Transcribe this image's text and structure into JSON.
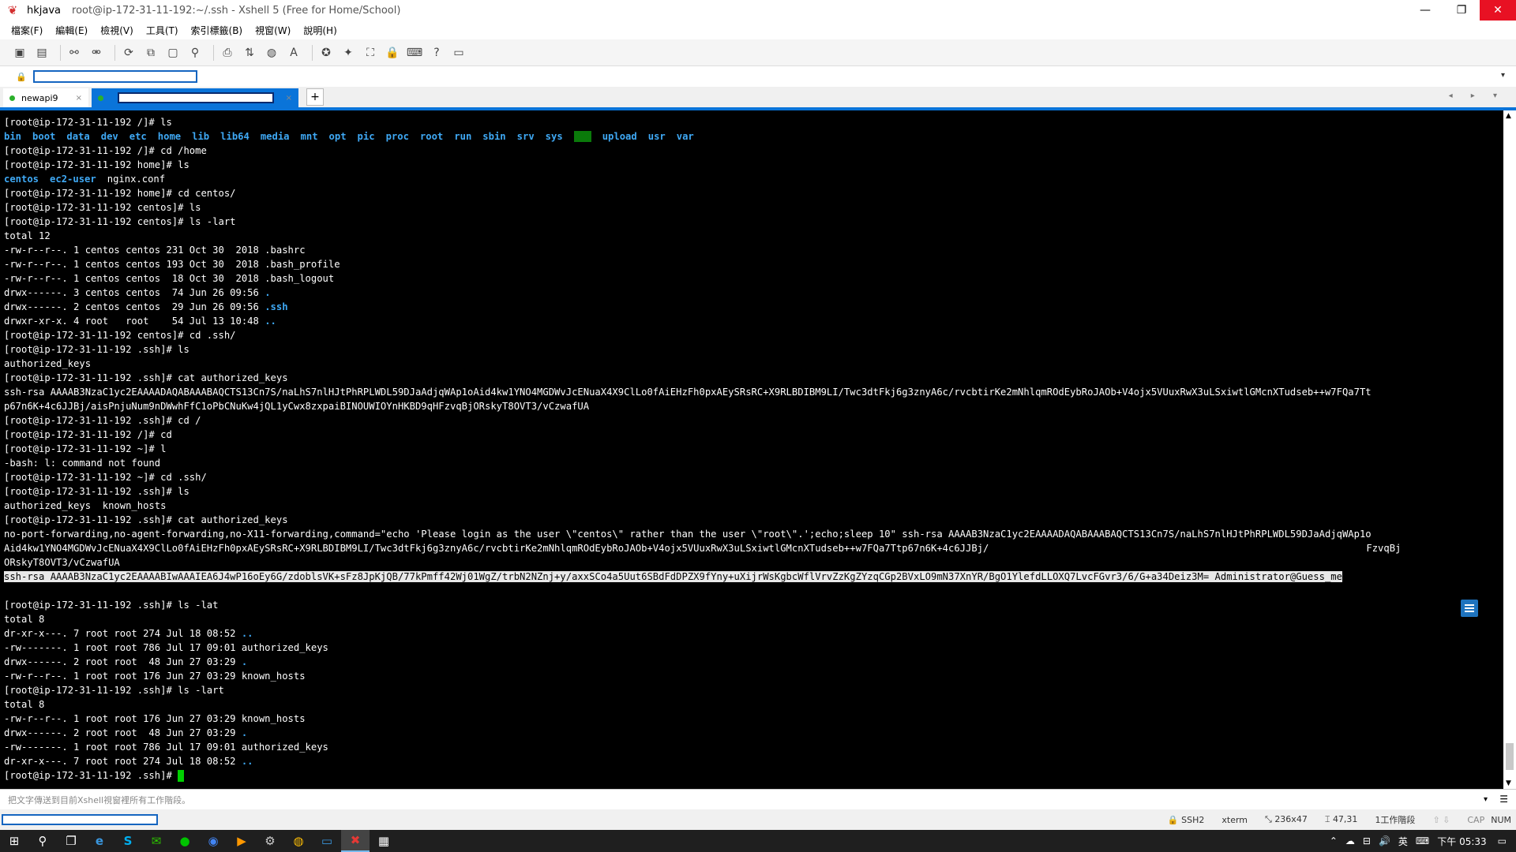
{
  "window": {
    "app_name": "hkjava",
    "path_title": "root@ip-172-31-11-192:~/.ssh - Xshell 5 (Free for Home/School)",
    "controls": {
      "minimize": "—",
      "restore": "❐",
      "close": "✕"
    }
  },
  "menu": [
    "檔案(F)",
    "編輯(E)",
    "檢視(V)",
    "工具(T)",
    "索引標籤(B)",
    "視窗(W)",
    "說明(H)"
  ],
  "tabs": {
    "tab1_label": "newapi9",
    "close_glyph": "×",
    "add_glyph": "+",
    "nav_glyphs": "◂ ▸ ▾"
  },
  "terminal": {
    "root_dirs": [
      "bin",
      "boot",
      "data",
      "dev",
      "etc",
      "home",
      "lib",
      "lib64",
      "media",
      "mnt",
      "opt",
      "pic",
      "proc",
      "root",
      "run",
      "sbin",
      "srv",
      "sys",
      "tmp",
      "upload",
      "usr",
      "var"
    ],
    "home_entries": [
      "centos",
      "ec2-user"
    ],
    "lines": {
      "l1": "[root@ip-172-31-11-192 /]# ls",
      "l3": "[root@ip-172-31-11-192 /]# cd /home",
      "l4": "[root@ip-172-31-11-192 home]# ls",
      "l5_file": "nginx.conf",
      "l6": "[root@ip-172-31-11-192 home]# cd centos/",
      "l7": "[root@ip-172-31-11-192 centos]# ls",
      "l8": "[root@ip-172-31-11-192 centos]# ls -lart",
      "l9": "total 12",
      "l10": "-rw-r--r--. 1 centos centos 231 Oct 30  2018 .bashrc",
      "l11": "-rw-r--r--. 1 centos centos 193 Oct 30  2018 .bash_profile",
      "l12": "-rw-r--r--. 1 centos centos  18 Oct 30  2018 .bash_logout",
      "l13_pre": "drwx------. 3 centos centos  74 Jun 26 09:56 ",
      "l13_dir": ".",
      "l14_pre": "drwx------. 2 centos centos  29 Jun 26 09:56 ",
      "l14_dir": ".ssh",
      "l15_pre": "drwxr-xr-x. 4 root   root    54 Jul 13 10:48 ",
      "l15_dir": "..",
      "l16": "[root@ip-172-31-11-192 centos]# cd .ssh/",
      "l17": "[root@ip-172-31-11-192 .ssh]# ls",
      "l18": "authorized_keys",
      "l19": "[root@ip-172-31-11-192 .ssh]# cat authorized_keys",
      "l20": "ssh-rsa AAAAB3NzaC1yc2EAAAADAQABAAABAQCTS13Cn7S/naLhS7nlHJtPhRPLWDL59DJaAdjqWAp1oAid4kw1YNO4MGDWvJcENuaX4X9ClLo0fAiEHzFh0pxAEySRsRC+X9RLBDIBM9LI/Twc3dtFkj6g3znyA6c/rvcbtirKe2mNhlqmROdEybRoJAOb+V4ojx5VUuxRwX3uLSxiwtlGMcnXTudseb++w7FQa7Tt",
      "l21": "p67n6K+4c6JJBj/aisPnjuNum9nDWwhFfC1oPbCNuKw4jQL1yCwx8zxpaiBINOUWIOYnHKBD9qHFzvqBjORskyT8OVT3/vCzwafUA",
      "l22": "[root@ip-172-31-11-192 .ssh]# cd /",
      "l23": "[root@ip-172-31-11-192 /]# cd",
      "l24": "[root@ip-172-31-11-192 ~]# l",
      "l25": "-bash: l: command not found",
      "l26": "[root@ip-172-31-11-192 ~]# cd .ssh/",
      "l27": "[root@ip-172-31-11-192 .ssh]# ls",
      "l28": "authorized_keys  known_hosts",
      "l29": "[root@ip-172-31-11-192 .ssh]# cat authorized_keys",
      "l30": "no-port-forwarding,no-agent-forwarding,no-X11-forwarding,command=\"echo 'Please login as the user \\\"centos\\\" rather than the user \\\"root\\\".';echo;sleep 10\" ssh-rsa AAAAB3NzaC1yc2EAAAADAQABAAABAQCTS13Cn7S/naLhS7nlHJtPhRPLWDL59DJaAdjqWAp1o",
      "l31a": "Aid4kw1YNO4MGDWvJcENuaX4X9ClLo0fAiEHzFh0pxAEySRsRC+X9RLBDIBM9LI/Twc3dtFkj6g3znyA6c/rvcbtirKe2mNhlqmROdEybRoJAOb+V4ojx5VUuxRwX3uLSxiwtlGMcnXTudseb++w7FQa7Ttp67n6K+4c6JJBj/",
      "l31b": "FzvqBj",
      "l32": "ORskyT8OVT3/vCzwafUA",
      "l33": "ssh-rsa AAAAB3NzaC1yc2EAAAABIwAAAIEA6J4wP16oEy6G/zdoblsVK+sFz8JpKjQB/77kPmff42Wj01WgZ/trbN2NZnj+y/axxSCo4a5Uut6SBdFdDPZX9fYny+uXijrWsKgbcWflVrvZzKgZYzqCGp2BVxLO9mN37XnYR/BgO1YlefdLLOXQ7LvcFGvr3/6/G+a34Deiz3M= Administrator@Guess_me",
      "l35": "[root@ip-172-31-11-192 .ssh]# ls -lat",
      "l36": "total 8",
      "l37_pre": "dr-xr-x---. 7 root root 274 Jul 18 08:52 ",
      "l37_dir": "..",
      "l38": "-rw-------. 1 root root 786 Jul 17 09:01 authorized_keys",
      "l39_pre": "drwx------. 2 root root  48 Jun 27 03:29 ",
      "l39_dir": ".",
      "l40": "-rw-r--r--. 1 root root 176 Jun 27 03:29 known_hosts",
      "l41": "[root@ip-172-31-11-192 .ssh]# ls -lart",
      "l42": "total 8",
      "l43": "-rw-r--r--. 1 root root 176 Jun 27 03:29 known_hosts",
      "l44_pre": "drwx------. 2 root root  48 Jun 27 03:29 ",
      "l44_dir": ".",
      "l45": "-rw-------. 1 root root 786 Jul 17 09:01 authorized_keys",
      "l46_pre": "dr-xr-x---. 7 root root 274 Jul 18 08:52 ",
      "l46_dir": "..",
      "l47": "[root@ip-172-31-11-192 .ssh]# "
    }
  },
  "input_bar": {
    "placeholder": "把文字傳送到目前Xshell視窗裡所有工作階段。",
    "arrow": "▾",
    "menu": "☰"
  },
  "status": {
    "protocol": "SSH2",
    "terminal_type": "xterm",
    "size": "236x47",
    "cursor_pos": "47,31",
    "sessions": "1工作階段",
    "caps": "CAP",
    "num": "NUM"
  },
  "taskbar": {
    "start": "⊞",
    "search": "⚲",
    "taskview": "❐",
    "apps": [
      "e",
      "S",
      "✉",
      "●",
      "◉",
      "▶",
      "⚙",
      "◍",
      "▭",
      "✖",
      "▦"
    ],
    "ime": "英",
    "time": "下午 05:33",
    "tray_icons": [
      "⌃",
      "☁",
      "⊟",
      "🔊"
    ]
  },
  "colors": {
    "dir": "#3fa9f5",
    "tab_accent": "#0a74d9",
    "cursor": "#00d000",
    "close": "#e81123"
  }
}
